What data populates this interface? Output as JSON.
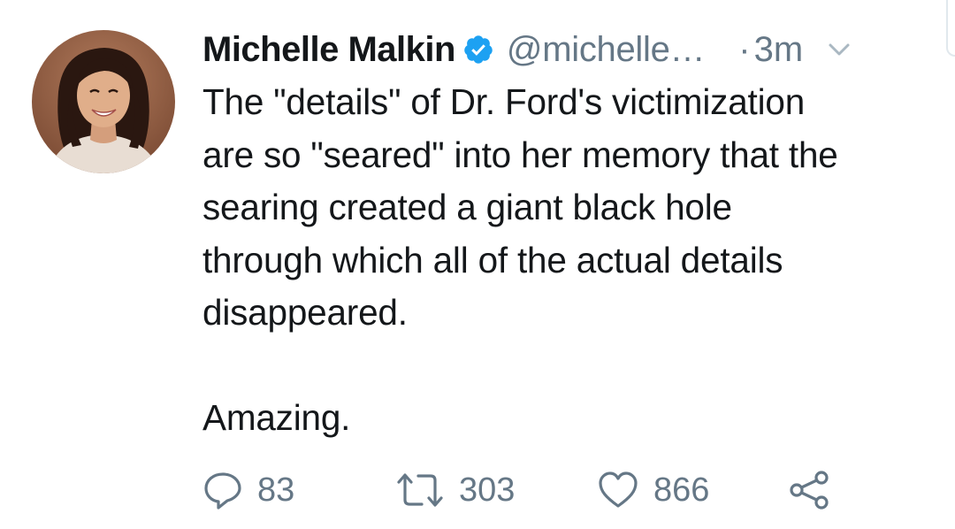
{
  "tweet": {
    "author": {
      "name": "Michelle Malkin",
      "handle": "@michelle…",
      "verified_icon": "verified-badge-icon",
      "avatar": "profile-photo"
    },
    "time_separator": "·",
    "time": "3m",
    "body": "The \"details\" of Dr. Ford's victimization\nare so \"seared\" into her memory that the\nsearing created a giant black hole\nthrough which all of the actual details\ndisappeared.\n\nAmazing.",
    "actions": {
      "reply": {
        "icon": "reply-icon",
        "count": "83"
      },
      "retweet": {
        "icon": "retweet-icon",
        "count": "303"
      },
      "like": {
        "icon": "heart-icon",
        "count": "866"
      },
      "share": {
        "icon": "share-icon"
      }
    }
  },
  "colors": {
    "text": "#14171a",
    "muted": "#657786",
    "verified": "#1da1f2",
    "border": "#e1e8ed"
  }
}
